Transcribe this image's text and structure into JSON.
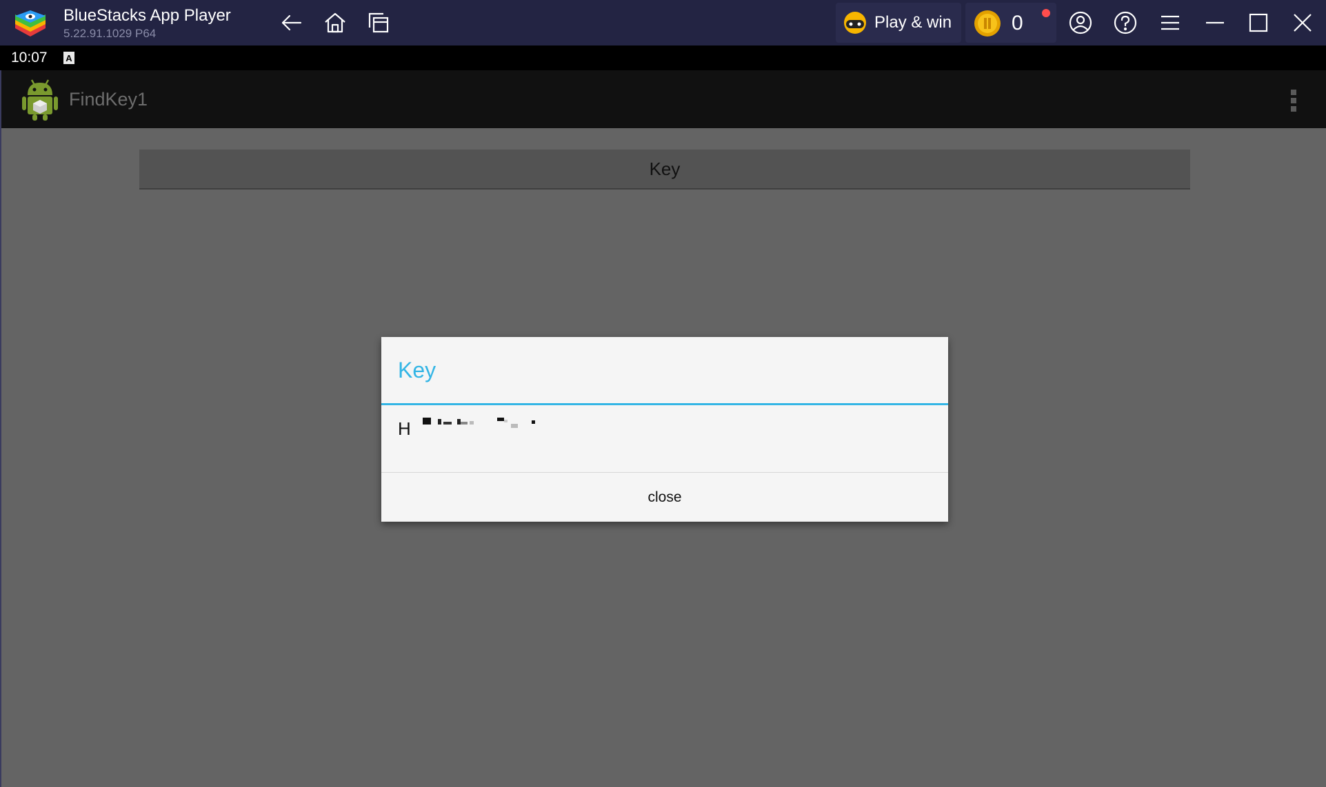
{
  "titlebar": {
    "title": "BlueStacks App Player",
    "version": "5.22.91.1029  P64",
    "play_win_label": "Play & win",
    "coin_count": "0",
    "icons": [
      "back-arrow-icon",
      "home-icon",
      "multi-instance-icon",
      "account-icon",
      "help-icon",
      "menu-icon",
      "minimize-icon",
      "maximize-icon",
      "close-icon"
    ]
  },
  "statusbar": {
    "time": "10:07",
    "indicator": "A"
  },
  "appbar": {
    "app_name": "FindKey1"
  },
  "content": {
    "key_button_label": "Key"
  },
  "dialog": {
    "title": "Key",
    "message_visible": "H",
    "close_label": "close"
  },
  "colors": {
    "titlebar_bg": "#232443",
    "accent": "#33b5e5",
    "content_bg": "#646464",
    "dialog_bg": "#f5f5f5",
    "notification_dot": "#ff4d4d"
  }
}
